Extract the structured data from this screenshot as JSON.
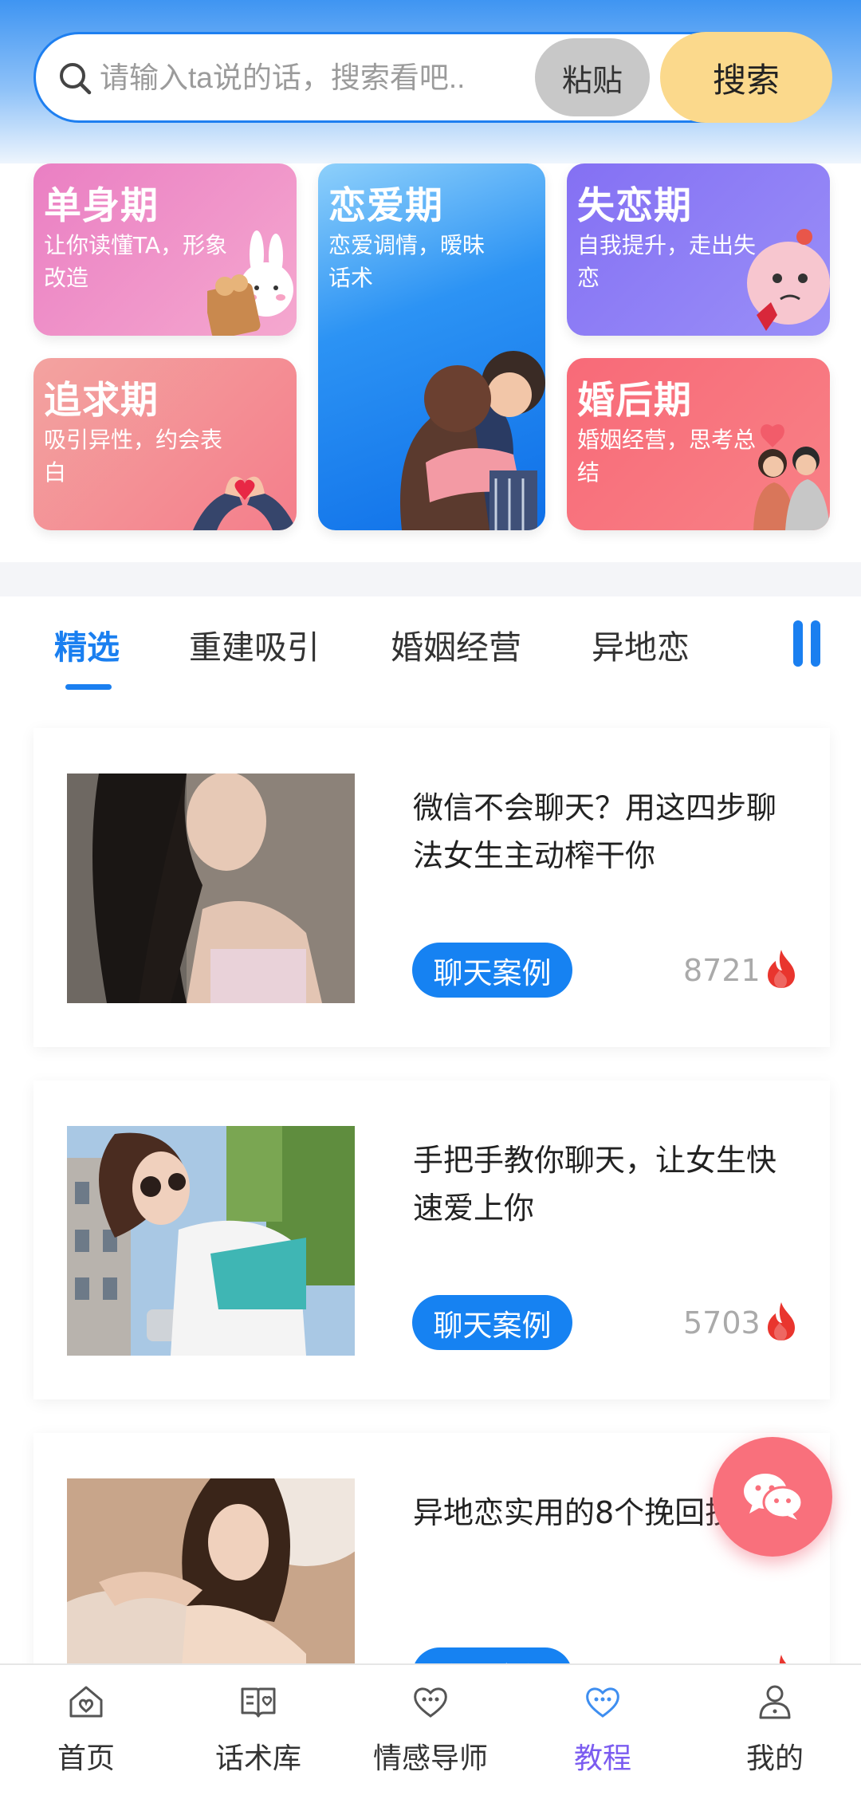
{
  "search": {
    "placeholder": "请输入ta说的话，搜索看吧..",
    "paste_label": "粘贴",
    "search_label": "搜索"
  },
  "stages": [
    {
      "title": "单身期",
      "subtitle": "让你读懂TA，形象改造"
    },
    {
      "title": "恋爱期",
      "subtitle": "恋爱调情，暧昧话术"
    },
    {
      "title": "失恋期",
      "subtitle": "自我提升，走出失恋"
    },
    {
      "title": "追求期",
      "subtitle": "吸引异性，约会表白"
    },
    {
      "title": "婚后期",
      "subtitle": "婚姻经营，思考总结"
    }
  ],
  "tabs": [
    {
      "label": "精选",
      "active": true
    },
    {
      "label": "重建吸引",
      "active": false
    },
    {
      "label": "婚姻经营",
      "active": false
    },
    {
      "label": "异地恋",
      "active": false
    }
  ],
  "articles": [
    {
      "title": "微信不会聊天？用这四步聊法女生主动榨干你",
      "tag": "聊天案例",
      "views": "8721"
    },
    {
      "title": "手把手教你聊天，让女生快速爱上你",
      "tag": "聊天案例",
      "views": "5703"
    },
    {
      "title": "异地恋实用的8个挽回技巧",
      "tag": "聊天案例",
      "views": ""
    }
  ],
  "nav": [
    {
      "label": "首页",
      "icon": "home-icon",
      "active": false
    },
    {
      "label": "话术库",
      "icon": "book-icon",
      "active": false
    },
    {
      "label": "情感导师",
      "icon": "heart-chat-icon",
      "active": false
    },
    {
      "label": "教程",
      "icon": "heart-chat-icon",
      "active": true
    },
    {
      "label": "我的",
      "icon": "user-icon",
      "active": false
    }
  ],
  "colors": {
    "primary": "#1a7ff0",
    "nav_active": "#7b5cf0",
    "fire": "#e9352e",
    "fab": "#f9707c"
  }
}
